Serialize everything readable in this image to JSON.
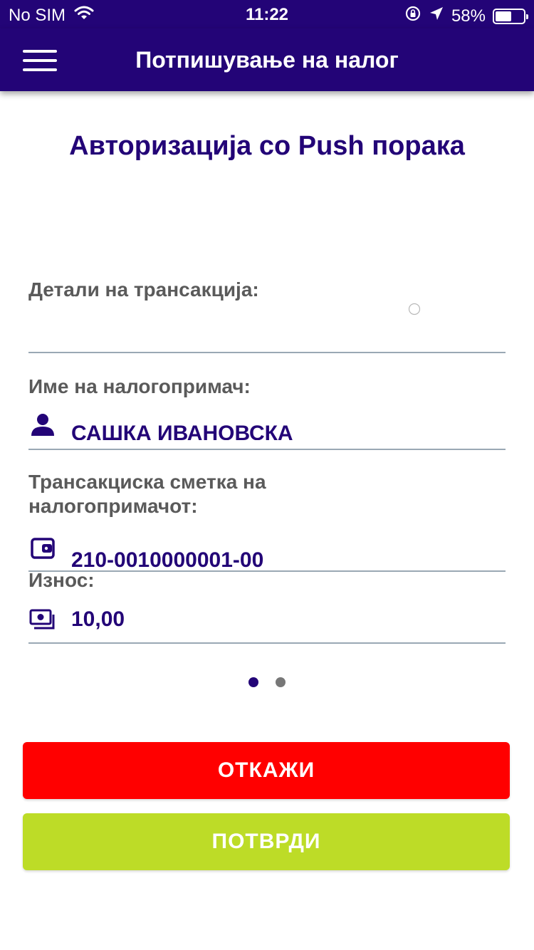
{
  "status_bar": {
    "carrier": "No SIM",
    "time": "11:22",
    "battery_percent": "58%",
    "battery_level": 0.58,
    "icons": [
      "wifi-icon",
      "orientation-lock-icon",
      "location-arrow-icon",
      "battery-icon"
    ]
  },
  "header": {
    "title": "Потпишување на налог",
    "menu_icon": "hamburger-menu-icon"
  },
  "page": {
    "heading": "Авторизација со Push порака"
  },
  "transaction": {
    "details_label": "Детали на трансакција:",
    "details_value": "",
    "recipient_name_label": "Име на налогопримач:",
    "recipient_name_value": "САШКА ИВАНОВСКА",
    "recipient_account_label_line1": "Трансакциска сметка на",
    "recipient_account_label_line2": "налогопримачот:",
    "recipient_account_value": "210-0010000001-00",
    "amount_label": "Износ:",
    "amount_value": "10,00",
    "icons": {
      "recipient": "person-icon",
      "account": "wallet-icon",
      "amount": "money-icon"
    }
  },
  "pager": {
    "page_count": 2,
    "active_index": 0
  },
  "actions": {
    "cancel_label": "ОТКАЖИ",
    "confirm_label": "ПОТВРДИ"
  },
  "colors": {
    "primary": "#230477",
    "cancel": "#ff0000",
    "confirm": "#bddc27",
    "label_gray": "#5a5a5a",
    "divider": "#9aa8b4",
    "dot_inactive": "#777777"
  }
}
